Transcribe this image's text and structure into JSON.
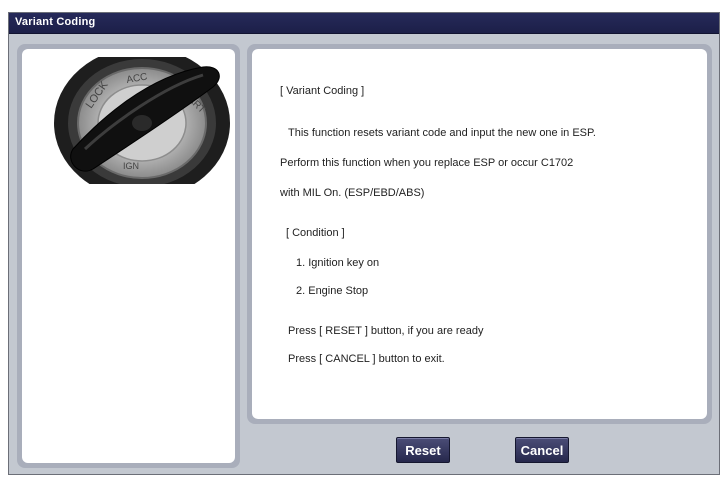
{
  "window": {
    "title": "Variant Coding"
  },
  "image": {
    "icon": "ignition-key-icon",
    "alt": "Ignition key"
  },
  "content": {
    "heading": "[ Variant Coding ]",
    "desc1": "This function resets variant code and input the new one in ESP.",
    "desc2": "Perform this function when you replace ESP or occur C1702",
    "desc3": "with MIL On. (ESP/EBD/ABS)",
    "condition_heading": "[ Condition ]",
    "conditions": [
      "1. Ignition key on",
      "2. Engine Stop"
    ],
    "press_reset": "Press [ RESET ] button, if you are ready",
    "press_cancel": "Press [ CANCEL ] button to exit."
  },
  "buttons": {
    "reset": "Reset",
    "cancel": "Cancel"
  },
  "colors": {
    "titlebar": "#1c1f48",
    "frame": "#c3c8d0",
    "panel_border": "#a9aebb",
    "button": "#2d2f58"
  }
}
